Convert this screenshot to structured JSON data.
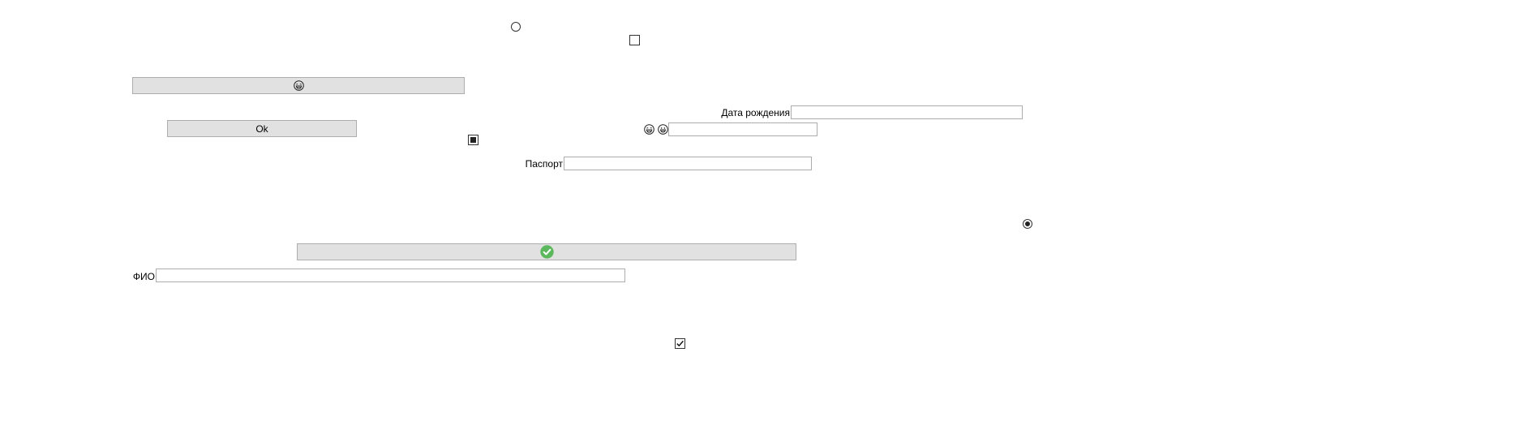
{
  "buttons": {
    "emoji_button_icon": "laughing-face-icon",
    "ok_label": "Ok",
    "check_button_icon": "green-checkmark-icon"
  },
  "fields": {
    "birth_date_label": "Дата рождения",
    "birth_date_value": "",
    "passport_label": "Паспорт",
    "passport_value": "",
    "fio_label": "ФИО",
    "fio_value": "",
    "emoji_field_value": ""
  },
  "emoji_field_icons": [
    "laughing-face-icon",
    "grinning-face-icon"
  ],
  "controls": {
    "radio_top_checked": false,
    "checkbox_top_checked": false,
    "checkbox_mid_state": "indeterminate",
    "radio_right_checked": true,
    "checkbox_bottom_checked": true
  },
  "colors": {
    "button_bg": "#e1e1e1",
    "button_border": "#adadad",
    "field_border": "#acacac",
    "check_green": "#5cb85c"
  }
}
